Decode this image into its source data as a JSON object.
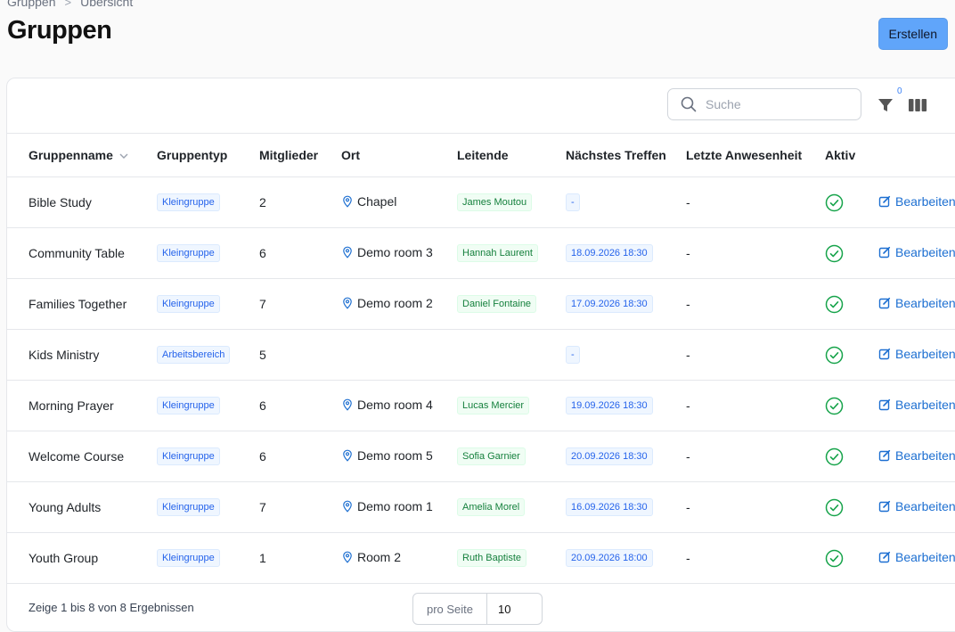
{
  "breadcrumb": [
    "Gruppen",
    "Übersicht"
  ],
  "page_title": "Gruppen",
  "create_button": "Erstellen",
  "search_placeholder": "Suche",
  "filter_count": "0",
  "columns": [
    "Gruppenname",
    "Gruppentyp",
    "Mitglieder",
    "Ort",
    "Leitende",
    "Nächstes Treffen",
    "Letzte Anwesenheit",
    "Aktiv"
  ],
  "edit_label": "Bearbeiten",
  "colors": {
    "accent": "#60a5fa",
    "link": "#1d6fd1",
    "active": "#16a34a"
  },
  "rows": [
    {
      "name": "Bible Study",
      "type": "Kleingruppe",
      "members": "2",
      "location": "Chapel",
      "leader": "James Moutou",
      "next_meeting": "-",
      "last_attendance": "-",
      "active": true
    },
    {
      "name": "Community Table",
      "type": "Kleingruppe",
      "members": "6",
      "location": "Demo room 3",
      "leader": "Hannah Laurent",
      "next_meeting": "18.09.2026 18:30",
      "last_attendance": "-",
      "active": true
    },
    {
      "name": "Families Together",
      "type": "Kleingruppe",
      "members": "7",
      "location": "Demo room 2",
      "leader": "Daniel Fontaine",
      "next_meeting": "17.09.2026 18:30",
      "last_attendance": "-",
      "active": true
    },
    {
      "name": "Kids Ministry",
      "type": "Arbeitsbereich",
      "members": "5",
      "location": "",
      "leader": "",
      "next_meeting": "-",
      "last_attendance": "-",
      "active": true
    },
    {
      "name": "Morning Prayer",
      "type": "Kleingruppe",
      "members": "6",
      "location": "Demo room 4",
      "leader": "Lucas Mercier",
      "next_meeting": "19.09.2026 18:30",
      "last_attendance": "-",
      "active": true
    },
    {
      "name": "Welcome Course",
      "type": "Kleingruppe",
      "members": "6",
      "location": "Demo room 5",
      "leader": "Sofia Garnier",
      "next_meeting": "20.09.2026 18:30",
      "last_attendance": "-",
      "active": true
    },
    {
      "name": "Young Adults",
      "type": "Kleingruppe",
      "members": "7",
      "location": "Demo room 1",
      "leader": "Amelia Morel",
      "next_meeting": "16.09.2026 18:30",
      "last_attendance": "-",
      "active": true
    },
    {
      "name": "Youth Group",
      "type": "Kleingruppe",
      "members": "1",
      "location": "Room 2",
      "leader": "Ruth Baptiste",
      "next_meeting": "20.09.2026 18:00",
      "last_attendance": "-",
      "active": true
    }
  ],
  "pagination": {
    "summary": "Zeige 1 bis 8 von 8 Ergebnissen",
    "per_page_label": "pro Seite",
    "per_page": "10"
  }
}
